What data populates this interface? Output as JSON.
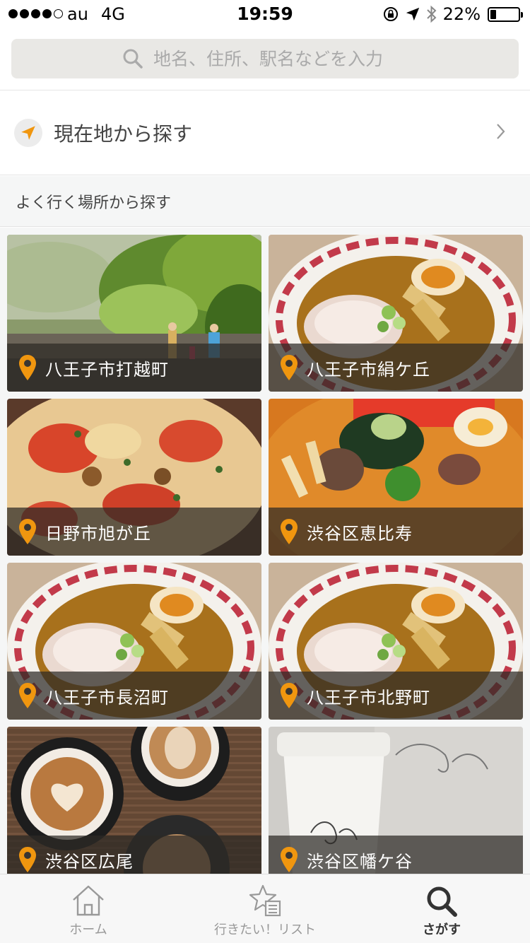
{
  "status_bar": {
    "carrier": "au",
    "network": "4G",
    "time": "19:59",
    "battery_percent_text": "22%",
    "battery_level": 0.22,
    "signal_bars_filled": 4,
    "signal_bars_total": 5
  },
  "search": {
    "placeholder": "地名、住所、駅名などを入力",
    "icon": "search-icon"
  },
  "current_location": {
    "label": "現在地から探す",
    "icon": "location-arrow-icon"
  },
  "section": {
    "title": "よく行く場所から探す"
  },
  "places": [
    {
      "name": "八王子市打越町",
      "theme": "nature"
    },
    {
      "name": "八王子市絹ケ丘",
      "theme": "ramen"
    },
    {
      "name": "日野市旭が丘",
      "theme": "pizza"
    },
    {
      "name": "渋谷区恵比寿",
      "theme": "soup-curry"
    },
    {
      "name": "八王子市長沼町",
      "theme": "ramen"
    },
    {
      "name": "八王子市北野町",
      "theme": "ramen"
    },
    {
      "name": "渋谷区広尾",
      "theme": "latte"
    },
    {
      "name": "渋谷区幡ケ谷",
      "theme": "coffee-cup"
    }
  ],
  "tabs": [
    {
      "label": "ホーム",
      "icon": "home-icon",
      "active": false
    },
    {
      "label": "行きたい！リスト",
      "icon": "star-list-icon",
      "active": false
    },
    {
      "label": "さがす",
      "icon": "search-icon",
      "active": true
    }
  ],
  "colors": {
    "accent": "#f0960f",
    "search_bg": "#e9e8e5",
    "section_bg": "#f5f6f6"
  }
}
